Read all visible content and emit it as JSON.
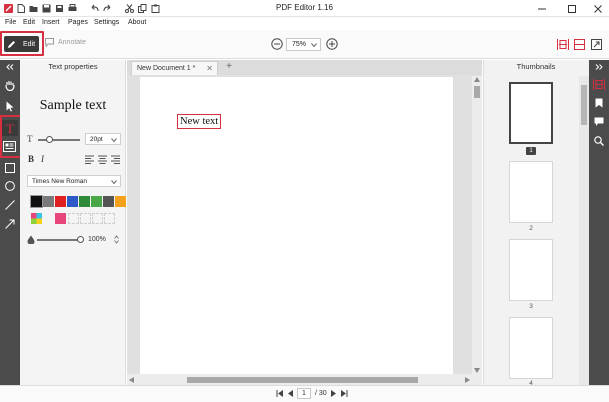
{
  "app": {
    "title": "PDF Editor 1.16"
  },
  "menu": [
    "File",
    "Edit",
    "Insert",
    "Pages",
    "Settings",
    "About"
  ],
  "toolbar": {
    "edit_label": "Edit",
    "annotate_label": "Annotate",
    "zoom_value": "75%"
  },
  "properties": {
    "title": "Text properties",
    "sample_text": "Sample text",
    "font_size": "20pt",
    "font_family": "Times New Roman",
    "opacity": "100%",
    "colors": [
      "#111111",
      "#7a7a7a",
      "#e02020",
      "#2e59c8",
      "#2f8a3a",
      "#48a848",
      "#555555",
      "#f4a21c"
    ],
    "selected_fill": "#e8457a"
  },
  "document": {
    "tab_label": "New Document 1 *",
    "text_box": "New text"
  },
  "thumbnails": {
    "title": "Thumbnails",
    "pages": [
      "1",
      "2",
      "3",
      "4"
    ]
  },
  "status": {
    "current_page": "1",
    "total_pages": "/ 30"
  },
  "colors": {
    "accent": "#d62f3f",
    "rail": "#4b4b4b"
  }
}
